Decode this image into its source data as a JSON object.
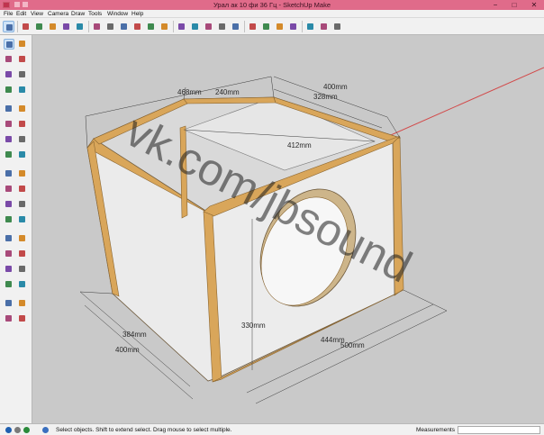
{
  "window": {
    "title": "Урал ак 10 фи 36 Гц - SketchUp Make"
  },
  "window_controls": {
    "minimize": "−",
    "maximize": "□",
    "close": "✕"
  },
  "menu": [
    "File",
    "Edit",
    "View",
    "Camera",
    "Draw",
    "Tools",
    "Window",
    "Help"
  ],
  "toolbar_icons": [
    "select-icon",
    "eraser-icon",
    "paint-bucket-icon",
    "pencil-icon",
    "arc-icon",
    "shapes-icon",
    "push-pull-icon",
    "offset-icon",
    "move-icon",
    "rotate-icon",
    "scale-icon",
    "follow-me-icon",
    "tape-measure-icon",
    "text-icon",
    "protractor-icon",
    "axes-icon",
    "orbit-icon",
    "pan-icon",
    "zoom-icon",
    "zoom-extents-icon",
    "3d-warehouse-icon",
    "extension-warehouse-icon",
    "layout-icon",
    "ruby-console-icon"
  ],
  "sidebar_icons": [
    "select-icon",
    "make-component-icon",
    "paint-bucket-icon",
    "eraser-icon",
    "line-icon",
    "freehand-icon",
    "rectangle-icon",
    "rotated-rectangle-icon",
    "circle-icon",
    "polygon-icon",
    "arc-icon",
    "two-point-arc-icon",
    "three-point-arc-icon",
    "pie-icon",
    "move-icon",
    "push-pull-icon",
    "rotate-icon",
    "follow-me-icon",
    "scale-icon",
    "offset-icon",
    "tape-measure-icon",
    "dimension-icon",
    "protractor-icon",
    "text-icon",
    "axes-icon",
    "3d-text-icon",
    "orbit-icon",
    "pan-icon",
    "zoom-icon",
    "zoom-window-icon",
    "zoom-extents-icon",
    "previous-view-icon",
    "position-camera-icon",
    "look-around-icon",
    "walk-icon",
    "section-plane-icon"
  ],
  "viewport": {
    "watermark": "vk.com/jbsound",
    "dimensions": {
      "front_width_top": "468mm",
      "inner_width_top": "240mm",
      "depth_top": "400mm",
      "inner_depth_top": "328mm",
      "inner_span": "412mm",
      "side_inner": "384mm",
      "side_outer": "400mm",
      "height": "330mm",
      "bottom_inner": "444mm",
      "bottom_outer": "500mm"
    }
  },
  "status": {
    "message": "Select objects. Shift to extend select. Drag mouse to select multiple.",
    "measurements_label": "Measurements",
    "measurements_value": ""
  },
  "colors": {
    "title_bar": "#e06b8a",
    "background": "#c9c9c9",
    "panel_face": "#ececec",
    "wood_edge": "#d9a65a",
    "axis_red": "#d24a4a"
  }
}
